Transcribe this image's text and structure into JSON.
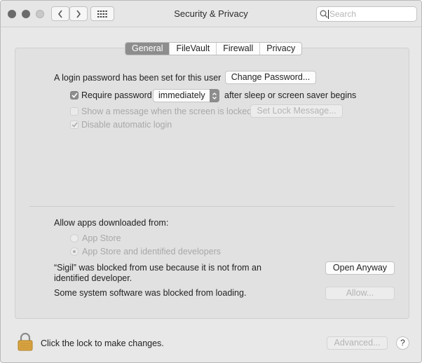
{
  "window": {
    "title": "Security & Privacy",
    "search_placeholder": "Search"
  },
  "tabs": [
    {
      "label": "General",
      "active": true
    },
    {
      "label": "FileVault",
      "active": false
    },
    {
      "label": "Firewall",
      "active": false
    },
    {
      "label": "Privacy",
      "active": false
    }
  ],
  "general": {
    "login_text": "A login password has been set for this user",
    "change_password_label": "Change Password...",
    "require_password": {
      "label": "Require password",
      "checked": true
    },
    "require_delay": "immediately",
    "after_text": "after sleep or screen saver begins",
    "show_message": {
      "label": "Show a message when the screen is locked",
      "checked": false,
      "enabled": false
    },
    "set_lock_message_label": "Set Lock Message...",
    "disable_auto_login": {
      "label": "Disable automatic login",
      "checked": true,
      "enabled": false
    }
  },
  "allow_apps": {
    "heading": "Allow apps downloaded from:",
    "option_app_store": "App Store",
    "option_identified": "App Store and identified developers",
    "blocked_message": "“Sigil” was blocked from use because it is not from an identified developer.",
    "blocked_line1": "“Sigil” was blocked from use because it is not from an",
    "blocked_line2": "identified developer.",
    "open_anyway_label": "Open Anyway",
    "system_software_text": "Some system software was blocked from loading.",
    "allow_label": "Allow..."
  },
  "footer": {
    "lock_text": "Click the lock to make changes.",
    "advanced_label": "Advanced...",
    "help_label": "?"
  },
  "colors": {
    "accent_gray": "#8d8d8d",
    "lock_gold": "#d9a441"
  }
}
